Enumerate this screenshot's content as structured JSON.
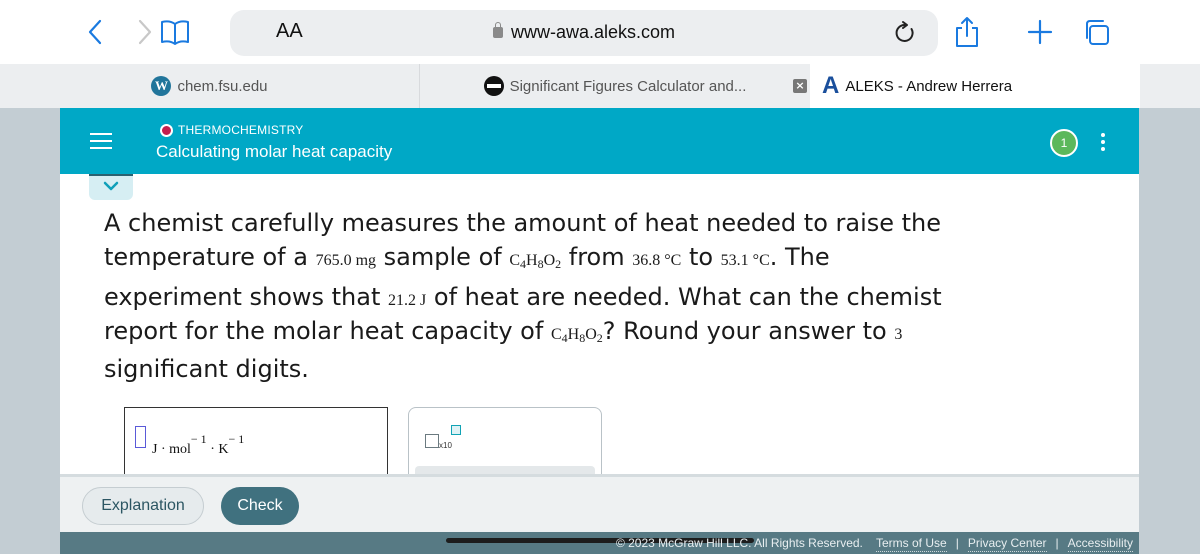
{
  "browser": {
    "text_size_label": "AA",
    "url": "www-awa.aleks.com",
    "icons": {
      "back": "chevron-left-icon",
      "forward": "chevron-right-icon",
      "bookmarks": "book-icon",
      "reload": "reload-icon",
      "share": "share-icon",
      "new_tab": "plus-icon",
      "tabs": "tabs-icon"
    },
    "tabs": [
      {
        "title": "chem.fsu.edu",
        "icon": "wordpress-icon",
        "active": false
      },
      {
        "title": "Significant Figures Calculator and...",
        "icon": "site-icon",
        "active": false
      },
      {
        "title": "ALEKS - Andrew Herrera",
        "icon": "aleks-icon",
        "active": true
      }
    ],
    "tab_close_label": "×"
  },
  "header": {
    "topic": "THERMOCHEMISTRY",
    "lesson_title": "Calculating molar heat capacity",
    "progress_count": "1",
    "colors": {
      "header_bg": "#00a8c6",
      "topic_dot": "#c41e4e",
      "badge": "#5cb85c"
    }
  },
  "question": {
    "line1": "A chemist carefully measures the amount of heat needed to raise the",
    "line2_a": "temperature of a ",
    "mass": "765.0 mg",
    "line2_b": " sample of ",
    "formula": {
      "c": "C",
      "c_sub": "4",
      "h": "H",
      "h_sub": "8",
      "o": "O",
      "o_sub": "2"
    },
    "line2_c": " from ",
    "t_initial": "36.8 °C",
    "line2_d": " to ",
    "t_final": "53.1 °C",
    "line2_e": ". The",
    "line3_a": "experiment shows that ",
    "heat": "21.2 J",
    "line3_b": " of heat are needed. What can the chemist",
    "line4_a": "report for the molar heat capacity of ",
    "line4_b": "? Round your answer to ",
    "sig_digits": "3",
    "line5": "significant digits."
  },
  "answer": {
    "value": "",
    "units": {
      "j": "J",
      "dot": "·",
      "mol": "mol",
      "mol_exp": "− 1",
      "k": "K",
      "k_exp": "− 1"
    },
    "tool_label": "x10"
  },
  "actions": {
    "explanation_label": "Explanation",
    "check_label": "Check"
  },
  "footer": {
    "copyright": "© 2023 McGraw Hill LLC. All Rights Reserved.",
    "links": [
      "Terms of Use",
      "Privacy Center",
      "Accessibility"
    ],
    "separator": "|"
  }
}
